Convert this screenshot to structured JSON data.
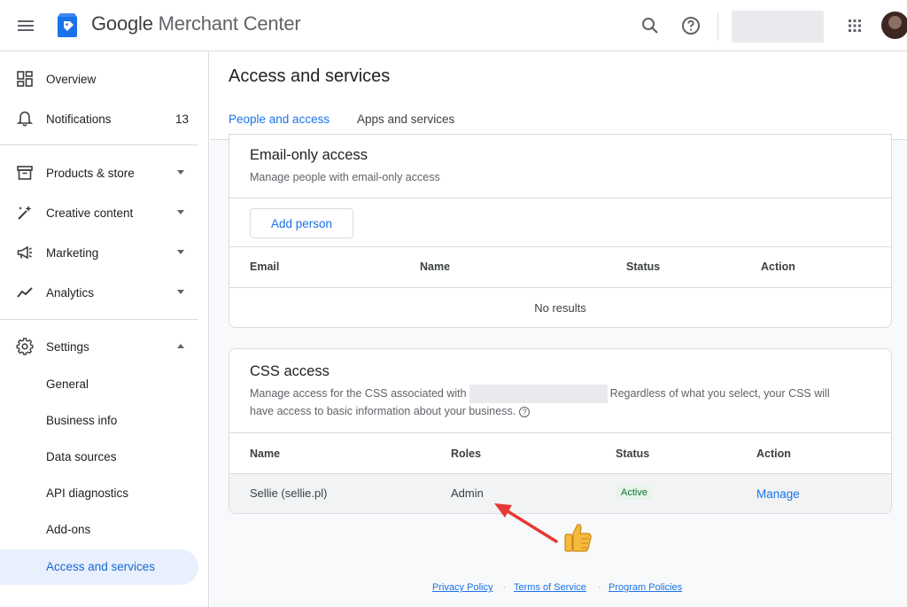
{
  "header": {
    "brand_google": "Google",
    "brand_product": "Merchant Center"
  },
  "sidebar": {
    "items": [
      {
        "label": "Overview"
      },
      {
        "label": "Notifications",
        "count": "13"
      },
      {
        "label": "Products & store"
      },
      {
        "label": "Creative content"
      },
      {
        "label": "Marketing"
      },
      {
        "label": "Analytics"
      },
      {
        "label": "Settings"
      }
    ],
    "settings_sub": [
      {
        "label": "General"
      },
      {
        "label": "Business info"
      },
      {
        "label": "Data sources"
      },
      {
        "label": "API diagnostics"
      },
      {
        "label": "Add-ons"
      },
      {
        "label": "Access and services"
      }
    ]
  },
  "main": {
    "title": "Access and services",
    "tabs": [
      {
        "label": "People and access"
      },
      {
        "label": "Apps and services"
      }
    ],
    "email_card": {
      "title": "Email-only access",
      "desc": "Manage people with email-only access",
      "add_button": "Add person",
      "columns": [
        "Email",
        "Name",
        "Status",
        "Action"
      ],
      "empty": "No results"
    },
    "css_card": {
      "title": "CSS access",
      "desc_part1": "Manage access for the CSS associated with",
      "desc_part2": "Regardless of what you select, your CSS will",
      "desc_line2": "have access to basic information about your business.",
      "help_glyph": "?",
      "columns": [
        "Name",
        "Roles",
        "Status",
        "Action"
      ],
      "rows": [
        {
          "name": "Sellie (sellie.pl)",
          "role": "Admin",
          "status": "Active",
          "action": "Manage"
        }
      ]
    }
  },
  "footer": {
    "links": [
      "Privacy Policy",
      "Terms of Service",
      "Program Policies"
    ],
    "separator": "·"
  },
  "colors": {
    "accent": "#1a73e8",
    "active_bg": "#e8f0fe",
    "status_green": "#137333",
    "annotation_red": "#e53935"
  }
}
